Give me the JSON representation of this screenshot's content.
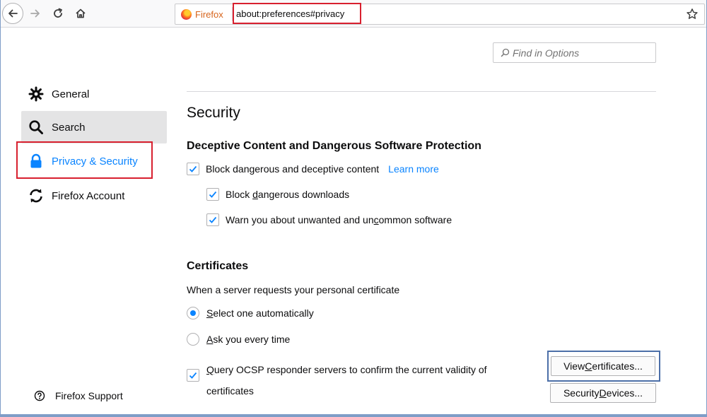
{
  "toolbar": {
    "identity_label": "Firefox",
    "url": "about:preferences#privacy"
  },
  "search": {
    "placeholder": "Find in Options"
  },
  "sidebar": {
    "items": [
      {
        "label": "General"
      },
      {
        "label": "Search"
      },
      {
        "label": "Privacy & Security"
      },
      {
        "label": "Firefox Account"
      }
    ],
    "support_label": "Firefox Support"
  },
  "main": {
    "section_title": "Security",
    "deceptive": {
      "heading": "Deceptive Content and Dangerous Software Protection",
      "block_label": "Block dangerous and deceptive content",
      "learn_more": "Learn more",
      "downloads_pre": "Block ",
      "downloads_ul": "d",
      "downloads_post": "angerous downloads",
      "unwanted_pre": "Warn you about unwanted and un",
      "unwanted_ul": "c",
      "unwanted_post": "ommon software"
    },
    "certificates": {
      "heading": "Certificates",
      "intro": "When a server requests your personal certificate",
      "auto_ul": "S",
      "auto_rest": "elect one automatically",
      "ask_ul": "A",
      "ask_rest": "sk you every time",
      "ocsp_ul": "Q",
      "ocsp_rest": "uery OCSP responder servers to confirm the current validity of certificates",
      "view_ul": "C",
      "view_pre": "View ",
      "view_post": "ertificates...",
      "devices_pre": "Security ",
      "devices_ul": "D",
      "devices_post": "evices..."
    }
  },
  "colors": {
    "accent": "#0a84ff",
    "highlight_red": "#d8202f",
    "focus_blue": "#4c6fa8"
  },
  "state": {
    "block_checked": true,
    "downloads_checked": true,
    "unwanted_checked": true,
    "certificate_choice": "Select one automatically",
    "ocsp_checked": true
  }
}
